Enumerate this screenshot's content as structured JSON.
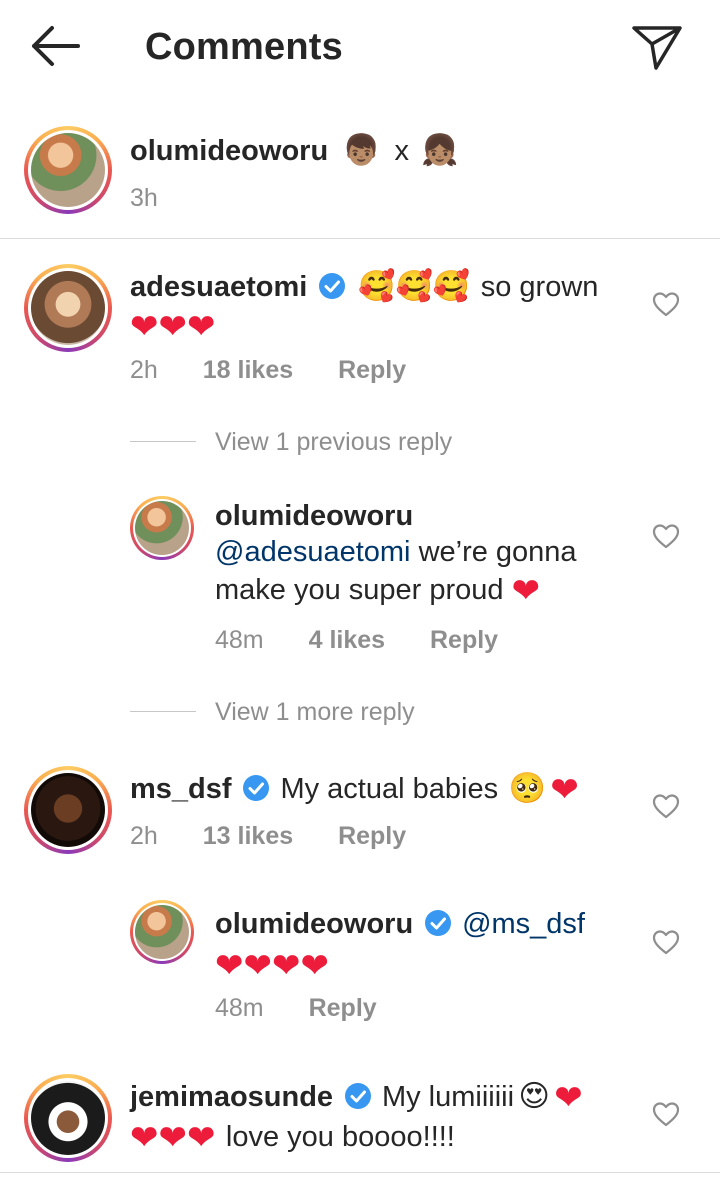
{
  "header": {
    "title": "Comments"
  },
  "caption": {
    "username": "olumideoworu",
    "text": "x",
    "time": "3h"
  },
  "comments": [
    {
      "username": "adesuaetomi",
      "line1": "so grown",
      "time": "2h",
      "likes": "18 likes",
      "reply": "Reply",
      "view_replies": "View 1 previous reply",
      "replies": [
        {
          "username": "olumideoworu",
          "mention": "@adesuaetomi",
          "line1": "we’re gonna",
          "line2": "make you super proud",
          "time": "48m",
          "likes": "4 likes",
          "reply": "Reply"
        }
      ],
      "view_more": "View 1 more reply"
    },
    {
      "username": "ms_dsf",
      "text": "My actual babies",
      "time": "2h",
      "likes": "13 likes",
      "reply": "Reply",
      "replies": [
        {
          "username": "olumideoworu",
          "mention": "@ms_dsf",
          "time": "48m",
          "reply": "Reply"
        }
      ]
    },
    {
      "username": "jemimaosunde",
      "text": "My lumiiiiii",
      "line2": "love you boooo!!!!"
    }
  ],
  "colors": {
    "heart": "#ed1c3a",
    "verified": "#3897f0",
    "mention": "#003569",
    "meta": "#8e8e8e"
  }
}
